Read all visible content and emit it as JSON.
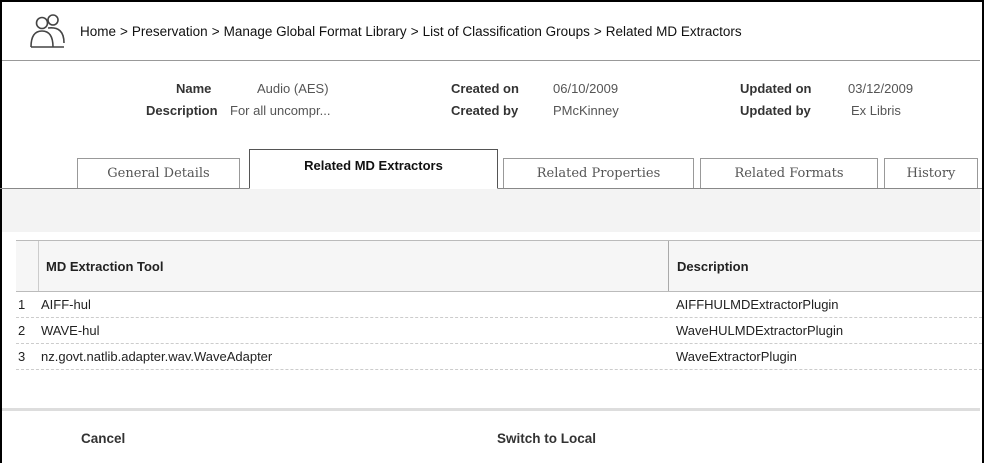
{
  "breadcrumb": {
    "items": [
      "Home",
      "Preservation",
      "Manage Global Format Library",
      "List of Classification Groups",
      "Related MD Extractors"
    ],
    "separator": ">"
  },
  "info": {
    "name_label": "Name",
    "name_value": "Audio (AES)",
    "description_label": "Description",
    "description_value": "For all uncompr...",
    "created_on_label": "Created on",
    "created_on_value": "06/10/2009",
    "created_by_label": "Created by",
    "created_by_value": "PMcKinney",
    "updated_on_label": "Updated on",
    "updated_on_value": "03/12/2009",
    "updated_by_label": "Updated by",
    "updated_by_value": "Ex Libris"
  },
  "tabs": [
    {
      "label": "General Details"
    },
    {
      "label": "Related MD Extractors",
      "active": true
    },
    {
      "label": "Related Properties"
    },
    {
      "label": "Related Formats"
    },
    {
      "label": "History"
    }
  ],
  "table": {
    "columns": [
      "MD Extraction Tool",
      "Description"
    ],
    "rows": [
      {
        "num": "1",
        "tool": "AIFF-hul",
        "description": "AIFFHULMDExtractorPlugin"
      },
      {
        "num": "2",
        "tool": "WAVE-hul",
        "description": "WaveHULMDExtractorPlugin"
      },
      {
        "num": "3",
        "tool": "nz.govt.natlib.adapter.wav.WaveAdapter",
        "description": "WaveExtractorPlugin"
      }
    ]
  },
  "footer": {
    "cancel_label": "Cancel",
    "switch_label": "Switch to Local"
  }
}
